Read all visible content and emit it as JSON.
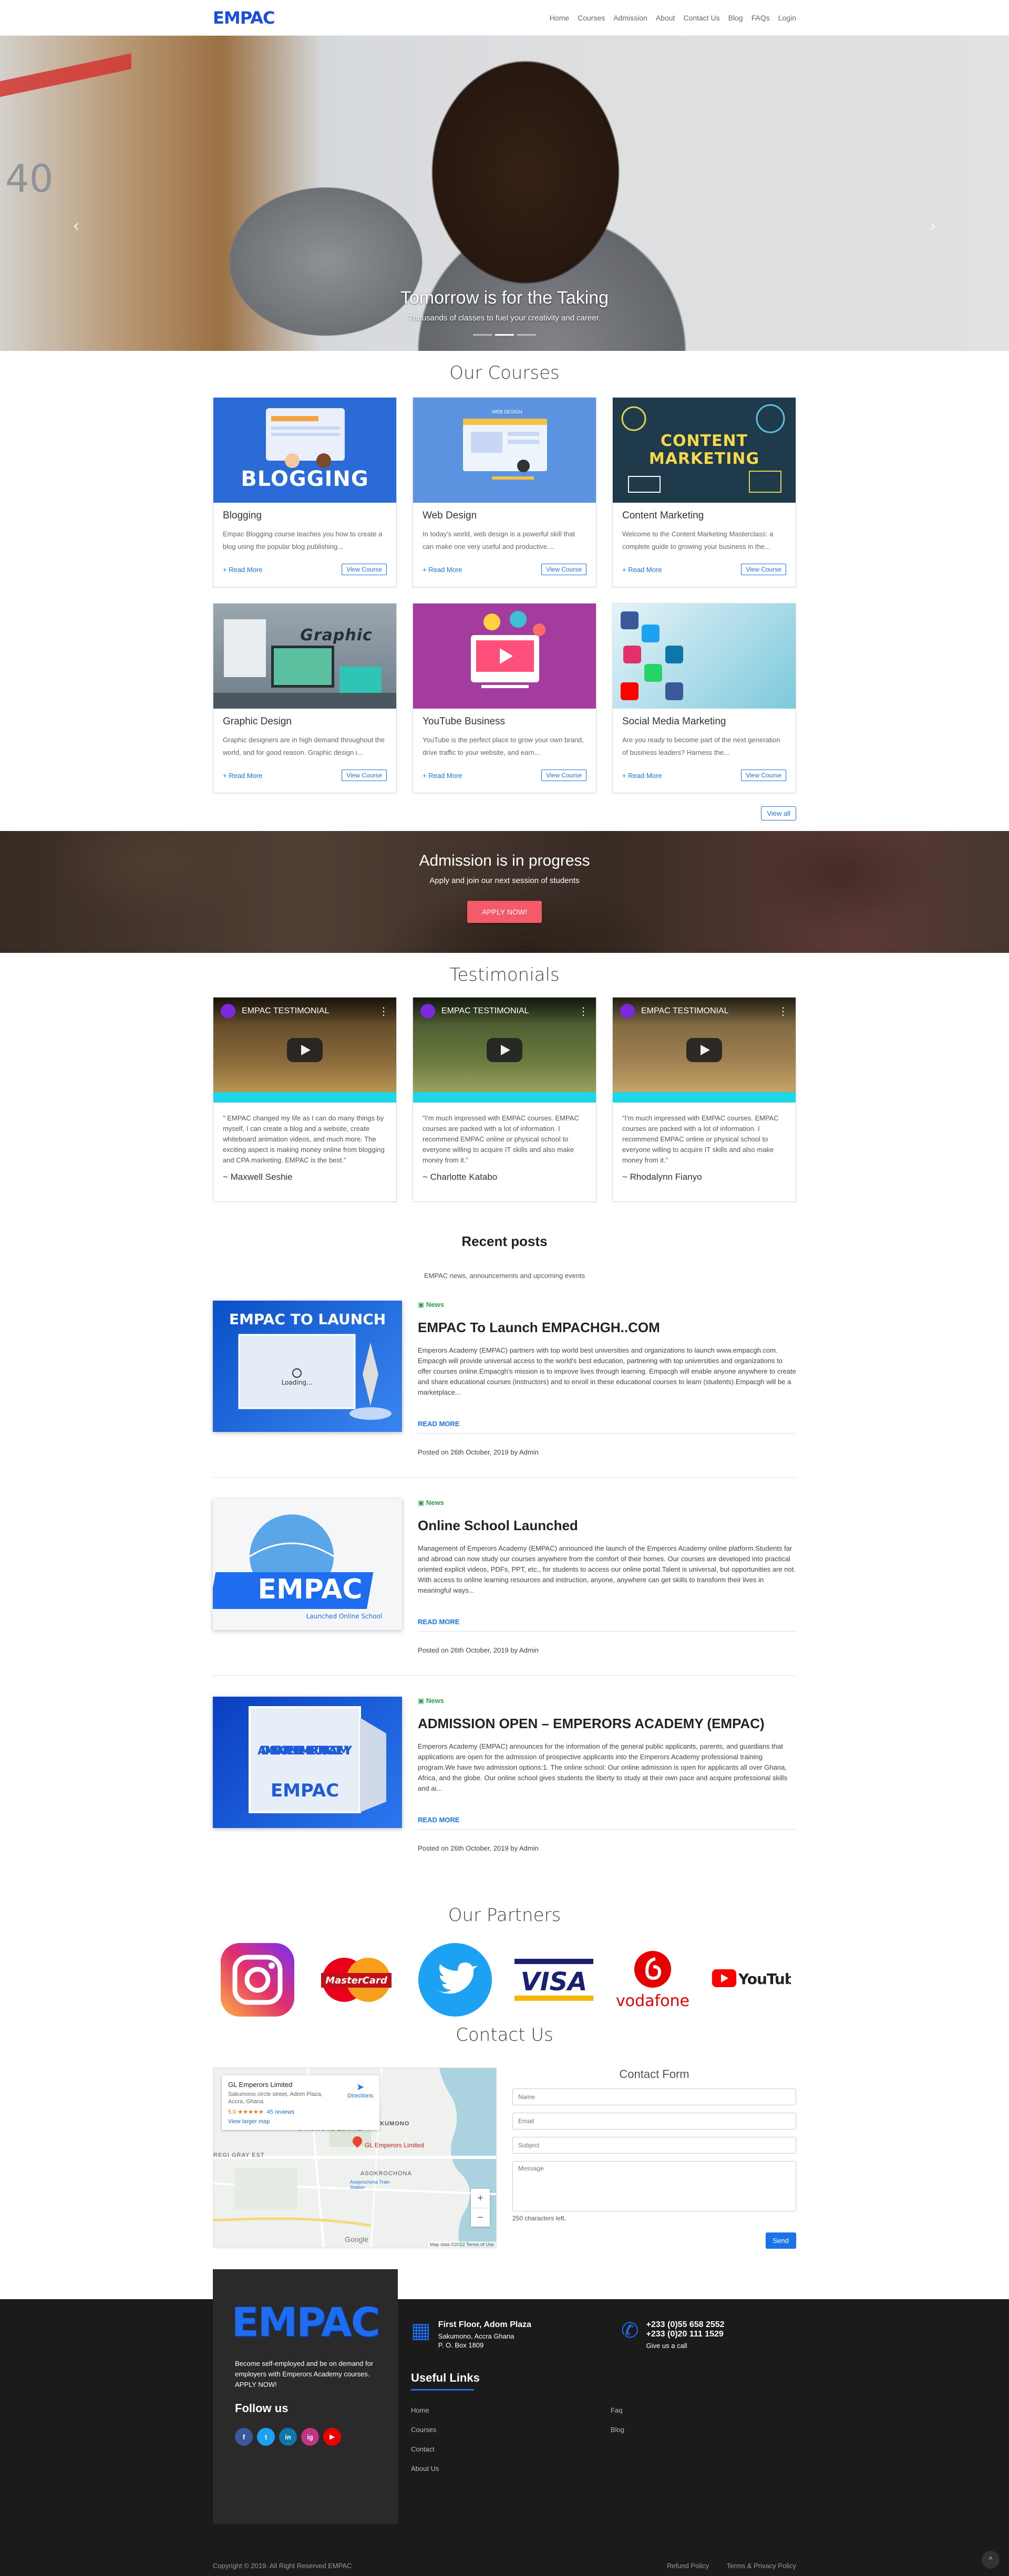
{
  "brand": {
    "name": "EMPAC",
    "color": "#1a4fd8"
  },
  "nav": {
    "items": [
      {
        "label": "Home"
      },
      {
        "label": "Courses"
      },
      {
        "label": "Admission"
      },
      {
        "label": "About"
      },
      {
        "label": "Contact Us"
      },
      {
        "label": "Blog"
      },
      {
        "label": "FAQs"
      },
      {
        "label": "Login"
      }
    ]
  },
  "hero": {
    "title": "Tomorrow is for the Taking",
    "subtitle": "Thousands of classes to fuel your creativity and career.",
    "prev_icon": "chevron-left",
    "next_icon": "chevron-right",
    "decor_number": "40",
    "slide_count": 3,
    "active_slide": 2
  },
  "courses": {
    "title": "Our Courses",
    "read_more": "+ Read More",
    "view_course": "View Course",
    "view_all": "View all",
    "items": [
      {
        "title": "Blogging",
        "desc": "Empac Blogging course teaches you how to create a blog using the popular blog publishing...",
        "img_text": "BLOGGING",
        "img_color": "#2a6bd8"
      },
      {
        "title": "Web Design",
        "desc": "In today's world, web design is a powerful skill that can make one very useful and productive....",
        "img_text": "WEB DESIGN",
        "img_color": "#5b93e0"
      },
      {
        "title": "Content Marketing",
        "desc": "Welcome to the Content Marketing Masterclass: a complete guide to growing your business in the...",
        "img_text": "CONTENT MARKETING",
        "img_color": "#1f3a4a"
      },
      {
        "title": "Graphic Design",
        "desc": "Graphic designers are in high demand throughout the world, and for good reason. Graphic design i...",
        "img_text": "Graphic",
        "img_color": "#6f7d88"
      },
      {
        "title": "YouTube Business",
        "desc": "YouTube is the perfect place to grow your own brand, drive traffic to your website, and earn...",
        "img_text": "",
        "img_color": "#a43c9e"
      },
      {
        "title": "Social Media Marketing",
        "desc": "Are you ready to become part of the next generation of business leaders? Harness the...",
        "img_text": "",
        "img_color": "#7cc9dc"
      }
    ]
  },
  "admission": {
    "title": "Admission is in progress",
    "subtitle": "Apply and join our next session of students",
    "cta": "APPLY NOW!"
  },
  "testimonials": {
    "title": "Testimonials",
    "video_title": "EMPAC TESTIMONIAL",
    "items": [
      {
        "quote": "\" EMPAC changed my life as I can do many things by myself, I can create a blog and a website, create whiteboard animation videos, and much more. The exciting aspect is making money online from blogging and CPA marketing. EMPAC is the best.\"",
        "name": "~ Maxwell Seshie",
        "bg": "#7a5a2e"
      },
      {
        "quote": "\"I'm much impressed with EMPAC courses. EMPAC courses are packed with a lot of information. I recommend EMPAC online or physical school to everyone willing to acquire IT skills and also make money from it.\"",
        "name": "~ Charlotte Katabo",
        "bg": "#5a7a3e"
      },
      {
        "quote": "\"I'm much impressed with EMPAC courses. EMPAC courses are packed with a lot of information. I recommend EMPAC online or physical school to everyone willing to acquire IT skills and also make money from it.\"",
        "name": "~ Rhodalynn Fianyo",
        "bg": "#8a6a3a"
      }
    ]
  },
  "recent": {
    "title": "Recent posts",
    "subtitle": "EMPAC news, announcements and upcoming events",
    "read_more": "READ MORE",
    "posts": [
      {
        "category": "News",
        "title": "EMPAC To Launch EMPACHGH..COM",
        "excerpt": "Emperors Academy (EMPAC) partners with top world best universities and organizations to launch www.empacgh.com. Empacgh will provide universal access to the world's best education, partnering with top universities and organizations to offer courses online.Empacgh's mission is to improve lives through learning. Empacgh will enable anyone anywhere to create and share educational courses (instructors) and to enroll in these educational courses to learn (students).Empacgh will be a marketplace...",
        "meta": "Posted on 26th October, 2019 by Admin",
        "img_caption": "EMPAC TO LAUNCH",
        "img_sub": "Loading..."
      },
      {
        "category": "News",
        "title": "Online School Launched",
        "excerpt": "Management of Emperors Academy (EMPAC) announced the launch of the Emperors Academy online platform.Students far and abroad can now study our courses anywhere from the comfort of their homes. Our courses are developed into practical oriented explicit videos, PDFs, PPT, etc., for students to access our online portal.Talent is universal, but opportunities are not. With access to online learning resources and instruction, anyone, anywhere can get skills to transform their lives in meaningful ways...",
        "meta": "Posted on 26th October, 2019 by Admin",
        "img_caption": "EMPAC",
        "img_sub": "Launched Online School"
      },
      {
        "category": "News",
        "title": "ADMISSION OPEN – EMPERORS ACADEMY (EMPAC)",
        "excerpt": "Emperors Academy (EMPAC) announces for the information of the general public applicants, parents, and guardians that applications are open for the admission of prospective applicants into the Emperors Academy professional training program.We have two admission options:1.   The online school: Our online admission is open for applicants all over Ghana, Africa, and the globe. Our online school gives students the liberty to study at their own pace and acquire professional skills and ai...",
        "meta": "Posted on 26th October, 2019 by Admin",
        "img_caption": "ADMISSION OPENED EMPERORS ACADEMY",
        "img_sub": "EMPAC"
      }
    ]
  },
  "partners": {
    "title": "Our Partners",
    "items": [
      {
        "name": "Instagram"
      },
      {
        "name": "MasterCard"
      },
      {
        "name": "Twitter"
      },
      {
        "name": "VISA"
      },
      {
        "name": "vodafone"
      },
      {
        "name": "YouTube"
      }
    ]
  },
  "contact": {
    "title": "Contact Us",
    "map": {
      "place": "GL Emperors Limited",
      "address": "Sakumono circle street, Adom Plaza, Accra, Ghana",
      "rating": "5.0 ★★★★★",
      "reviews": "45 reviews",
      "larger": "View larger map",
      "directions": "Directions",
      "pin_label": "GL Emperors Limited",
      "estate": "SAKUMONO ESTATE",
      "sakumono": "SAKUMONO",
      "gray": "REGI GRAY EST",
      "asokrochona": "ASOKROCHONA",
      "station": "Asoprochona Train Station",
      "google": "Google",
      "footer": "Map data ©2022   Terms of Use"
    },
    "form": {
      "title": "Contact Form",
      "name_ph": "Name",
      "email_ph": "Email",
      "subject_ph": "Subject",
      "message_ph": "Message",
      "chars": "250 characters left.",
      "send": "Send"
    }
  },
  "footer": {
    "logo": "EMPAC",
    "tagline": "Become self-employed and be on demand for employers with Emperors Academy courses. APPLY NOW!",
    "follow": "Follow us",
    "socials": [
      {
        "icon": "f",
        "name": "facebook",
        "color": "#3b5998"
      },
      {
        "icon": "t",
        "name": "twitter",
        "color": "#1da1f2"
      },
      {
        "icon": "in",
        "name": "linkedin",
        "color": "#0e76a8"
      },
      {
        "icon": "ig",
        "name": "instagram",
        "color": "#c13584"
      },
      {
        "icon": "▶",
        "name": "youtube",
        "color": "#e00"
      }
    ],
    "address_title": "First Floor, Adom Plaza",
    "address_line1": "Sakumono, Accra Ghana",
    "address_line2": "P. O. Box 1809",
    "phone1": "+233 (0)55 658 2552",
    "phone2": "+233 (0)20 111 1529",
    "phone_sub": "Give us a call",
    "useful": "Useful Links",
    "links": [
      {
        "label": "Home"
      },
      {
        "label": "Faq"
      },
      {
        "label": "Courses"
      },
      {
        "label": "Blog"
      },
      {
        "label": "Contact"
      },
      {
        "label": ""
      },
      {
        "label": "About Us"
      },
      {
        "label": ""
      }
    ],
    "copyright": "Copyright © 2019. All Right Reserved EMPAC",
    "refund": "Refund Policy",
    "terms": "Terms & Privacy Policy",
    "to_top": "^"
  }
}
